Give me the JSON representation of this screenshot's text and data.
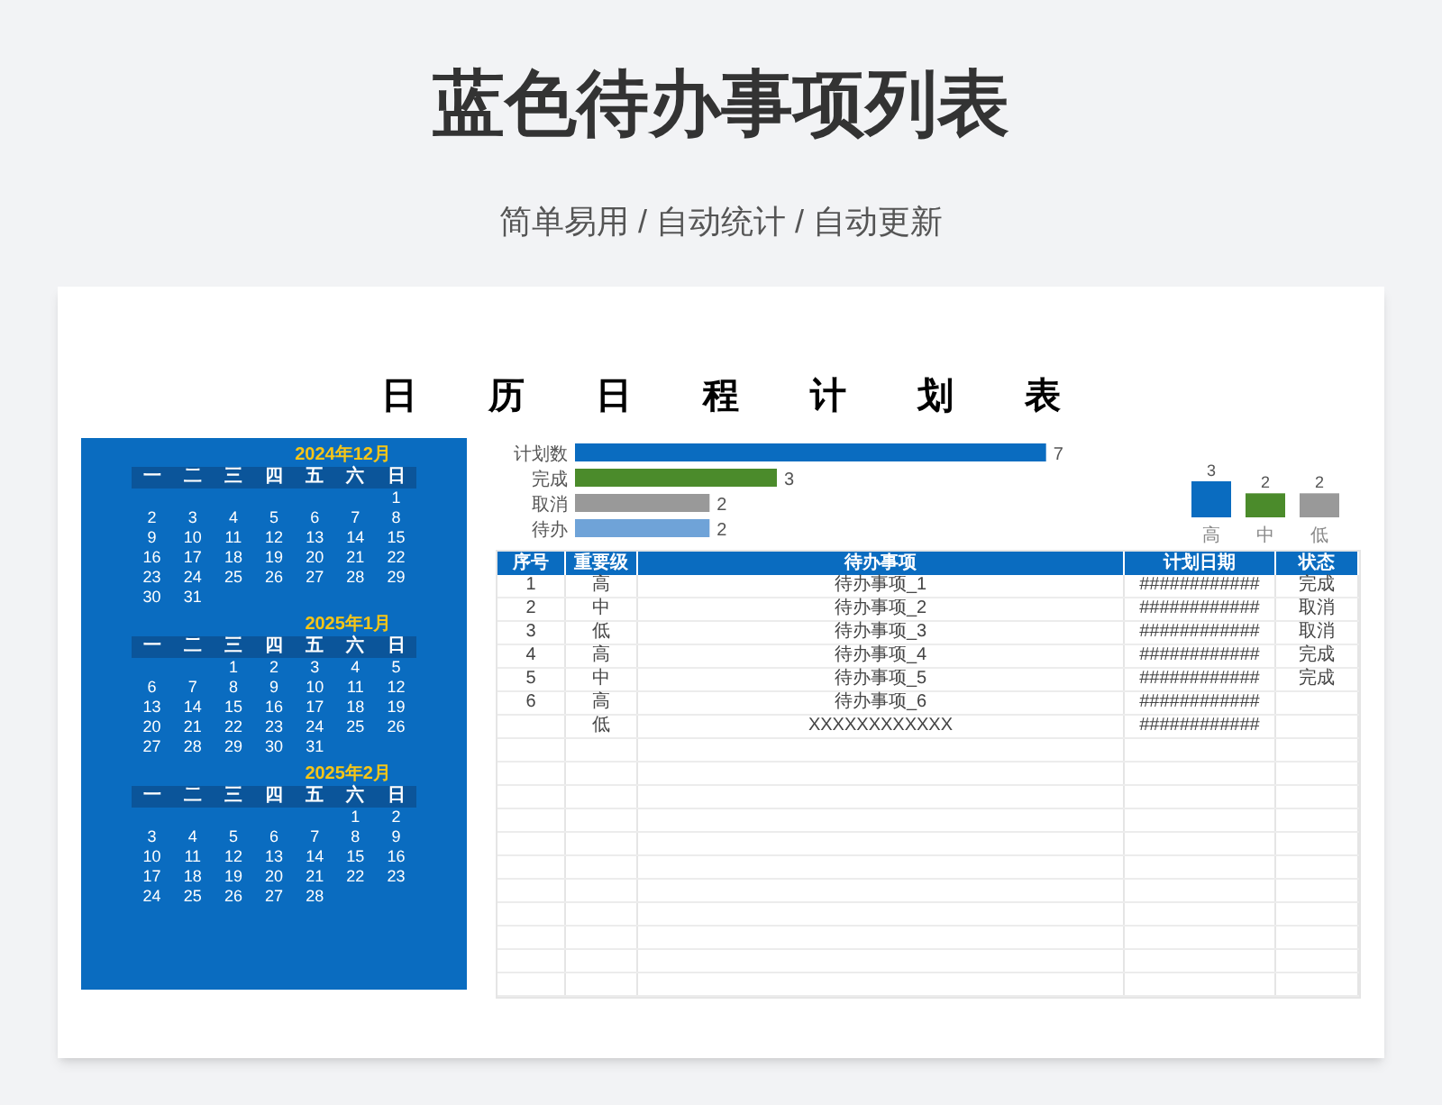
{
  "header": {
    "title": "蓝色待办事项列表",
    "subtitle": "简单易用 / 自动统计 / 自动更新"
  },
  "sheet": {
    "title": "日 历 日 程 计 划 表",
    "calendars": [
      {
        "title": "2024年12月",
        "weekdays": [
          "一",
          "二",
          "三",
          "四",
          "五",
          "六",
          "日"
        ],
        "weeks": [
          {
            "sun": "1"
          },
          {
            "mon": "2",
            "tue": "3",
            "wed": "4",
            "thu": "5",
            "fri": "6",
            "sat": "7",
            "sun": "8"
          },
          {
            "mon": "9",
            "tue": "10",
            "wed": "11",
            "thu": "12",
            "fri": "13",
            "sat": "14",
            "sun": "15"
          },
          {
            "mon": "16",
            "tue": "17",
            "wed": "18",
            "thu": "19",
            "fri": "20",
            "sat": "21",
            "sun": "22"
          },
          {
            "mon": "23",
            "tue": "24",
            "wed": "25",
            "thu": "26",
            "fri": "27",
            "sat": "28",
            "sun": "29"
          },
          {
            "mon": "30",
            "tue": "31"
          }
        ]
      },
      {
        "title": "2025年1月",
        "weekdays": [
          "一",
          "二",
          "三",
          "四",
          "五",
          "六",
          "日"
        ],
        "weeks": [
          {
            "wed": "1",
            "thu": "2",
            "fri": "3",
            "sat": "4",
            "sun": "5"
          },
          {
            "mon": "6",
            "tue": "7",
            "wed": "8",
            "thu": "9",
            "fri": "10",
            "sat": "11",
            "sun": "12"
          },
          {
            "mon": "13",
            "tue": "14",
            "wed": "15",
            "thu": "16",
            "fri": "17",
            "sat": "18",
            "sun": "19"
          },
          {
            "mon": "20",
            "tue": "21",
            "wed": "22",
            "thu": "23",
            "fri": "24",
            "sat": "25",
            "sun": "26"
          },
          {
            "mon": "27",
            "tue": "28",
            "wed": "29",
            "thu": "30",
            "fri": "31"
          }
        ]
      },
      {
        "title": "2025年2月",
        "weekdays": [
          "一",
          "二",
          "三",
          "四",
          "五",
          "六",
          "日"
        ],
        "weeks": [
          {
            "sat": "1",
            "sun": "2"
          },
          {
            "mon": "3",
            "tue": "4",
            "wed": "5",
            "thu": "6",
            "fri": "7",
            "sat": "8",
            "sun": "9"
          },
          {
            "mon": "10",
            "tue": "11",
            "wed": "12",
            "thu": "13",
            "fri": "14",
            "sat": "15",
            "sun": "16"
          },
          {
            "mon": "17",
            "tue": "18",
            "wed": "19",
            "thu": "20",
            "fri": "21",
            "sat": "22",
            "sun": "23"
          },
          {
            "mon": "24",
            "tue": "25",
            "wed": "26",
            "thu": "27",
            "fri": "28"
          }
        ]
      }
    ],
    "status_chart": {
      "chart_data": {
        "type": "bar",
        "orientation": "horizontal",
        "stacked": true,
        "data_labels": true,
        "categories": [
          "计划数",
          "完成",
          "取消",
          "待办"
        ],
        "series": [
          {
            "color": "#0a6cc0",
            "values": [
              7,
              null,
              null,
              null
            ]
          },
          {
            "color": "#4b8b2b",
            "values": [
              null,
              3,
              null,
              null
            ]
          },
          {
            "color": "#999999",
            "values": [
              null,
              null,
              2,
              null
            ]
          },
          {
            "color": "#6fa3d8",
            "values": [
              null,
              null,
              null,
              2
            ]
          }
        ]
      }
    },
    "priority_chart": {
      "chart_data": {
        "type": "bar",
        "orientation": "vertical",
        "stacked": true,
        "data_labels": true,
        "categories": [
          "高",
          "中",
          "低"
        ],
        "series": [
          {
            "color": "#0a6cc0",
            "values": [
              3,
              null,
              null
            ]
          },
          {
            "color": "#4b8b2b",
            "values": [
              null,
              2,
              null
            ]
          },
          {
            "color": "#999999",
            "values": [
              null,
              null,
              2
            ]
          }
        ]
      }
    },
    "table": {
      "columns": [
        "序号",
        "重要级",
        "待办事项",
        "计划日期",
        "状态"
      ],
      "rows": [
        [
          "1",
          "高",
          "待办事项_1",
          "############",
          "完成"
        ],
        [
          "2",
          "中",
          "待办事项_2",
          "############",
          "取消"
        ],
        [
          "3",
          "低",
          "待办事项_3",
          "############",
          "取消"
        ],
        [
          "4",
          "高",
          "待办事项_4",
          "############",
          "完成"
        ],
        [
          "5",
          "中",
          "待办事项_5",
          "############",
          "完成"
        ],
        [
          "6",
          "高",
          "待办事项_6",
          "############",
          null
        ],
        [
          null,
          "低",
          "XXXXXXXXXXXX",
          "############",
          null
        ]
      ]
    }
  }
}
